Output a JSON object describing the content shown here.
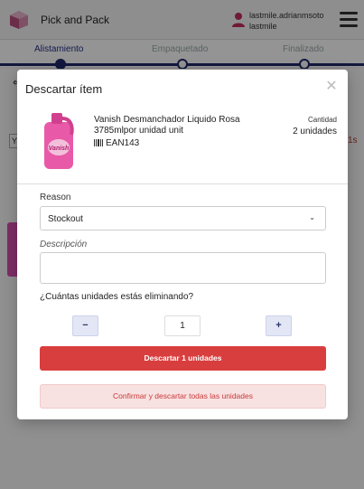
{
  "header": {
    "app_title": "Pick and Pack",
    "user_line1": "lastmile.adrianmsoto",
    "user_line2": "lastmile"
  },
  "steps": [
    {
      "label": "Alistamiento",
      "state": "active"
    },
    {
      "label": "Empaquetado",
      "state": "pending"
    },
    {
      "label": "Finalizado",
      "state": "pending"
    }
  ],
  "background": {
    "ya_tag": "Ya",
    "right_tag": "1s"
  },
  "modal": {
    "title": "Descartar ítem",
    "product": {
      "name": "Vanish Desmanchador Liquido Rosa 3785mlpor unidad unit",
      "ean": "EAN143",
      "quantity_label": "Cantidad",
      "quantity_value": "2 unidades"
    },
    "reason": {
      "label": "Reason",
      "selected": "Stockout"
    },
    "description": {
      "label": "Descripción",
      "value": ""
    },
    "units": {
      "question": "¿Cuántas unidades estás eliminando?",
      "minus": "−",
      "plus": "+",
      "value": "1"
    },
    "buttons": {
      "discard": "Descartar 1 unidades",
      "discard_all": "Confirmar y descartar todas las unidades"
    }
  },
  "colors": {
    "primary_navy": "#1f2a6b",
    "danger_red": "#d93e3e",
    "danger_light": "#f8e1e1",
    "stepper_bg": "#e3e7f5"
  },
  "icons": [
    "box-logo-icon",
    "user-icon",
    "menu-icon",
    "close-icon",
    "barcode-icon",
    "chevron-down-icon"
  ]
}
